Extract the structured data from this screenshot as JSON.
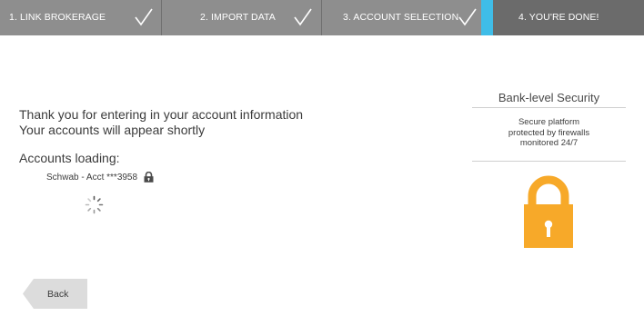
{
  "stepper": {
    "steps": [
      {
        "label": "1. LINK BROKERAGE",
        "done": true
      },
      {
        "label": "2. IMPORT DATA",
        "done": true
      },
      {
        "label": "3. ACCOUNT SELECTION",
        "done": true
      },
      {
        "label": "4. YOU'RE DONE!",
        "current": true
      }
    ],
    "colors": {
      "step_bg": "#8e8e8e",
      "current_bg": "#6b6b6b",
      "accent": "#3fbde8"
    }
  },
  "main": {
    "message_line1": "Thank you for entering in your account information",
    "message_line2": "Your accounts will appear shortly",
    "loading_title": "Accounts loading:",
    "account": "Schwab - Acct ***3958"
  },
  "back_button": {
    "label": "Back"
  },
  "security": {
    "title": "Bank-level Security",
    "lines": [
      "Secure platform",
      "protected by firewalls",
      "monitored 24/7"
    ],
    "lock_color": "#f7a929"
  }
}
